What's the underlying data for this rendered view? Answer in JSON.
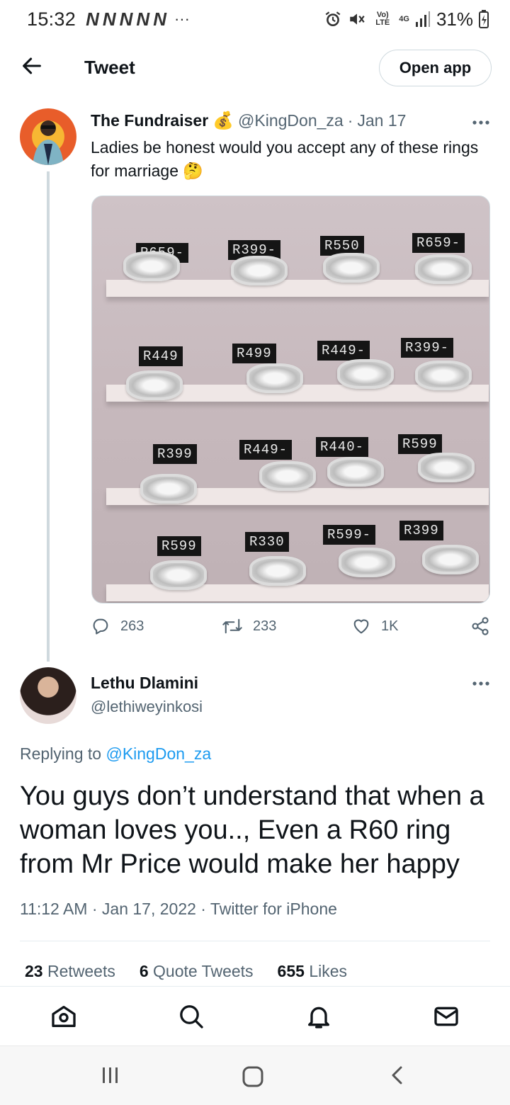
{
  "status_bar": {
    "time": "15:32",
    "notification_icons": [
      "N",
      "N",
      "N",
      "N",
      "N"
    ],
    "more_dots": "···",
    "volte": "Vo) LTE",
    "network": "4G",
    "battery": "31%"
  },
  "header": {
    "title": "Tweet",
    "open_app_label": "Open app"
  },
  "tweet": {
    "author_name": "The Fundraiser",
    "badge_emoji": "💰",
    "handle": "@KingDon_za",
    "separator": "·",
    "date": "Jan 17",
    "text": "Ladies be honest would you accept any of these rings for marriage 🤔",
    "media_price_tags": [
      [
        "R659-",
        "R399-",
        "R550",
        "R659-"
      ],
      [
        "R449",
        "R499",
        "R449-",
        "R399-"
      ],
      [
        "R399",
        "R449-",
        "R440-",
        "R599"
      ],
      [
        "R599",
        "R330",
        "R599-",
        "R399"
      ]
    ],
    "actions": {
      "replies": "263",
      "retweets": "233",
      "likes": "1K"
    }
  },
  "reply": {
    "author_name": "Lethu Dlamini",
    "handle": "@lethiweyinkosi",
    "replying_prefix": "Replying to",
    "replying_to": "@KingDon_za",
    "text": "You guys don’t understand that when a woman loves you.., Even a R60 ring from Mr Price would make her happy",
    "meta": "11:12 AM · Jan 17, 2022 · Twitter for iPhone",
    "stats": {
      "retweets_count": "23",
      "retweets_label": "Retweets",
      "quotes_count": "6",
      "quotes_label": "Quote Tweets",
      "likes_count": "655",
      "likes_label": "Likes"
    }
  },
  "colors": {
    "accent": "#1d9bf0",
    "secondary_text": "#536471",
    "primary_text": "#0f1419",
    "border": "#cfd9de"
  },
  "icons": {
    "back": "arrow-left-icon",
    "more": "more-horizontal-icon",
    "reply": "reply-icon",
    "retweet": "retweet-icon",
    "like": "heart-icon",
    "share": "share-icon",
    "home": "home-icon",
    "search": "search-icon",
    "notifications": "bell-icon",
    "messages": "mail-icon"
  }
}
